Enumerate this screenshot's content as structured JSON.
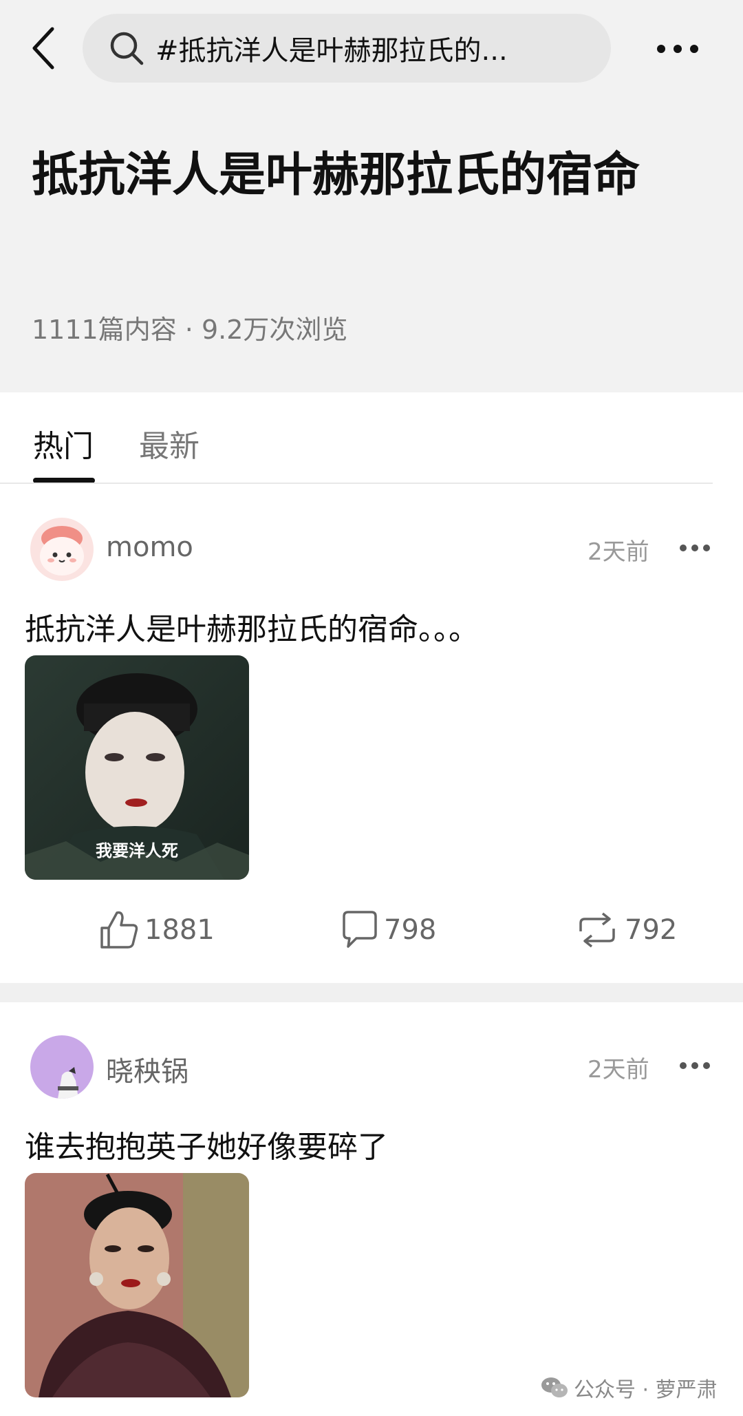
{
  "search": {
    "query": "#抵抗洋人是叶赫那拉氏的..."
  },
  "topic": {
    "title": "抵抗洋人是叶赫那拉氏的宿命",
    "stats": "1111篇内容 · 9.2万次浏览"
  },
  "tabs": [
    {
      "label": "热门",
      "active": true
    },
    {
      "label": "最新",
      "active": false
    }
  ],
  "posts": [
    {
      "username": "momo",
      "time": "2天前",
      "text": "抵抗洋人是叶赫那拉氏的宿命。。。",
      "image_caption": "我要洋人死",
      "likes": "1881",
      "comments": "798",
      "reposts": "792"
    },
    {
      "username": "晓秧锅",
      "time": "2天前",
      "text": "谁去抱抱英子她好像要碎了"
    }
  ],
  "watermark": "公众号 · 萝严肃"
}
